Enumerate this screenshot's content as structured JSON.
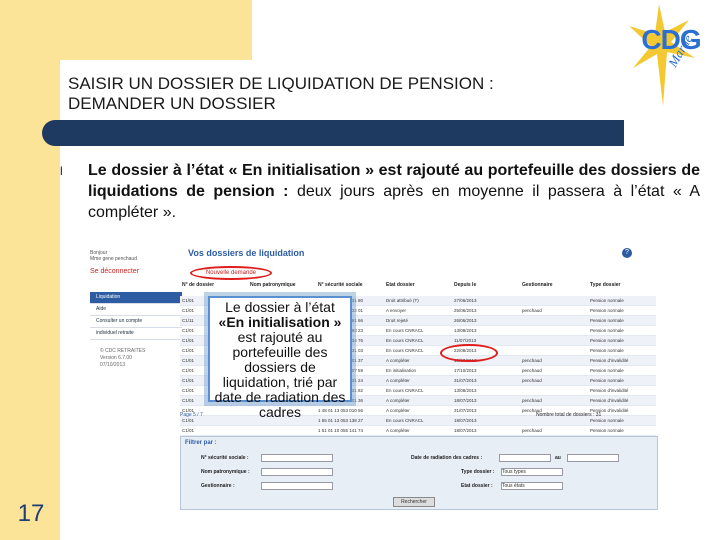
{
  "slide": {
    "page_number": "17",
    "title_line1": "SAISIR UN DOSSIER DE LIQUIDATION DE PENSION :",
    "title_line2": "DEMANDER UN DOSSIER",
    "bullet_symbol": "l",
    "bullet_bold": "Le dossier à l’état « En initialisation » est rajouté au portefeuille des dossiers de liquidations de pension :",
    "bullet_normal": " deux jours après en moyenne il passera à l’état « A compléter ».",
    "logo_text": "CDG",
    "logo_sub": "Marne",
    "colors": {
      "title_bar": "#1f3a60",
      "accent_yellow": "#fbe397",
      "highlight_red": "#e01c1c",
      "link_blue": "#2d5ca3"
    }
  },
  "app": {
    "user_line1": "Bonjour",
    "user_line2": "Mme gene penchaud",
    "logout_label": "Se déconnecter",
    "menu": [
      {
        "label": "Liquidation",
        "active": true
      },
      {
        "label": "Aide",
        "active": false
      },
      {
        "label": "Consulter un compte",
        "active": false
      },
      {
        "label": "individuel retraite",
        "active": false
      }
    ],
    "version_line1": "© CDC RETRAITES",
    "version_line2": "Version 6.7.00",
    "version_line3": "07/10/2013",
    "page_title": "Vos dossiers de liquidation",
    "help_icon": "?",
    "new_request_label": "Nouvelle demande",
    "columns": [
      "N° de dossier",
      "Nom patronymique",
      "N° sécurité sociale",
      "Etat dossier",
      "Depuis le",
      "Gestionnaire",
      "Type dossier"
    ],
    "rows": [
      [
        "C1/01",
        "",
        "1 45 01 13 047 131 80",
        "Droit attribué (T)",
        "27/06/2013",
        "",
        "Pension normale"
      ],
      [
        "C1/01",
        "",
        "1 54 03 13 053 032 01",
        "A envoyer",
        "25/06/2013",
        "penchaud",
        "Pension normale"
      ],
      [
        "C1/11",
        "",
        "1 51 10 55 001 091 66",
        "Droit rejeté",
        "26/06/2013",
        "",
        "Pension normale"
      ],
      [
        "C1/01",
        "",
        "1 50 02 13 055 083 23",
        "En cours CNRACL",
        "13/08/2013",
        "",
        "Pension normale"
      ],
      [
        "C1/01",
        "",
        "1 55 01 13 370 034 76",
        "En cours CNRACL",
        "11/07/2013",
        "",
        "Pension normale"
      ],
      [
        "C1/01",
        "",
        "1 50 01 13 053 031 03",
        "En cours CNRACL",
        "22/08/2013",
        "",
        "Pension normale"
      ],
      [
        "C1/01",
        "",
        "2 49 01 10 053 001 37",
        "A compléter",
        "18/07/2013",
        "penchaud",
        "Pension d'invalidité"
      ],
      [
        "C1/01",
        "",
        "1 59 01 13 063 107 59",
        "En initialisation",
        "17/10/2013",
        "penchaud",
        "Pension normale"
      ],
      [
        "C1/01",
        "",
        "2 56 01 55 023 131 24",
        "A compléter",
        "31/07/2013",
        "penchaud",
        "Pension normale"
      ],
      [
        "C1/01",
        "",
        "1 55 03 13 023 131 82",
        "En cours CNRACL",
        "13/08/2013",
        "",
        "Pension d'invalidité"
      ],
      [
        "C1/01",
        "",
        "2 49 01 13 053 001 36",
        "A compléter",
        "18/07/2013",
        "penchaud",
        "Pension d'invalidité"
      ],
      [
        "C1/01",
        "",
        "1 48 01 13 053 010 56",
        "A compléter",
        "31/07/2013",
        "penchaud",
        "Pension d'invalidité"
      ],
      [
        "C1/01",
        "",
        "1 55 01 13 053 138 27",
        "En cours CNRACL",
        "18/07/2013",
        "",
        "Pension normale"
      ],
      [
        "C1/01",
        "",
        "1 51 01 10 055 141 74",
        "A compléter",
        "18/07/2013",
        "penchaud",
        "Pension normale"
      ],
      [
        "C1/01",
        "",
        "2 61 10 51 656 231 14",
        "A compléter",
        "31/07/2013",
        "penchaud",
        "Pension normale"
      ]
    ],
    "pager": "Page 5 / 7",
    "total_label": "Nombre total de dossiers : 31",
    "filter_title": "Filtrer par :",
    "filter_ss_label": "N° sécurité sociale :",
    "filter_name_label": "Nom patronymique :",
    "filter_manager_label": "Gestionnaire :",
    "filter_date_label": "Date de radiation des cadres :",
    "filter_date_to": "au",
    "filter_type_label": "Type dossier :",
    "filter_type_value": "Tous types",
    "filter_state_label": "Etat dossier :",
    "filter_state_value": "Tous états",
    "search_label": "Rechercher"
  },
  "callout": {
    "line1": "Le dossier à l’état",
    "line2": "«En initialisation »",
    "line3": "est rajouté au portefeuille des dossiers de liquidation, trié par date de radiation des cadres"
  }
}
